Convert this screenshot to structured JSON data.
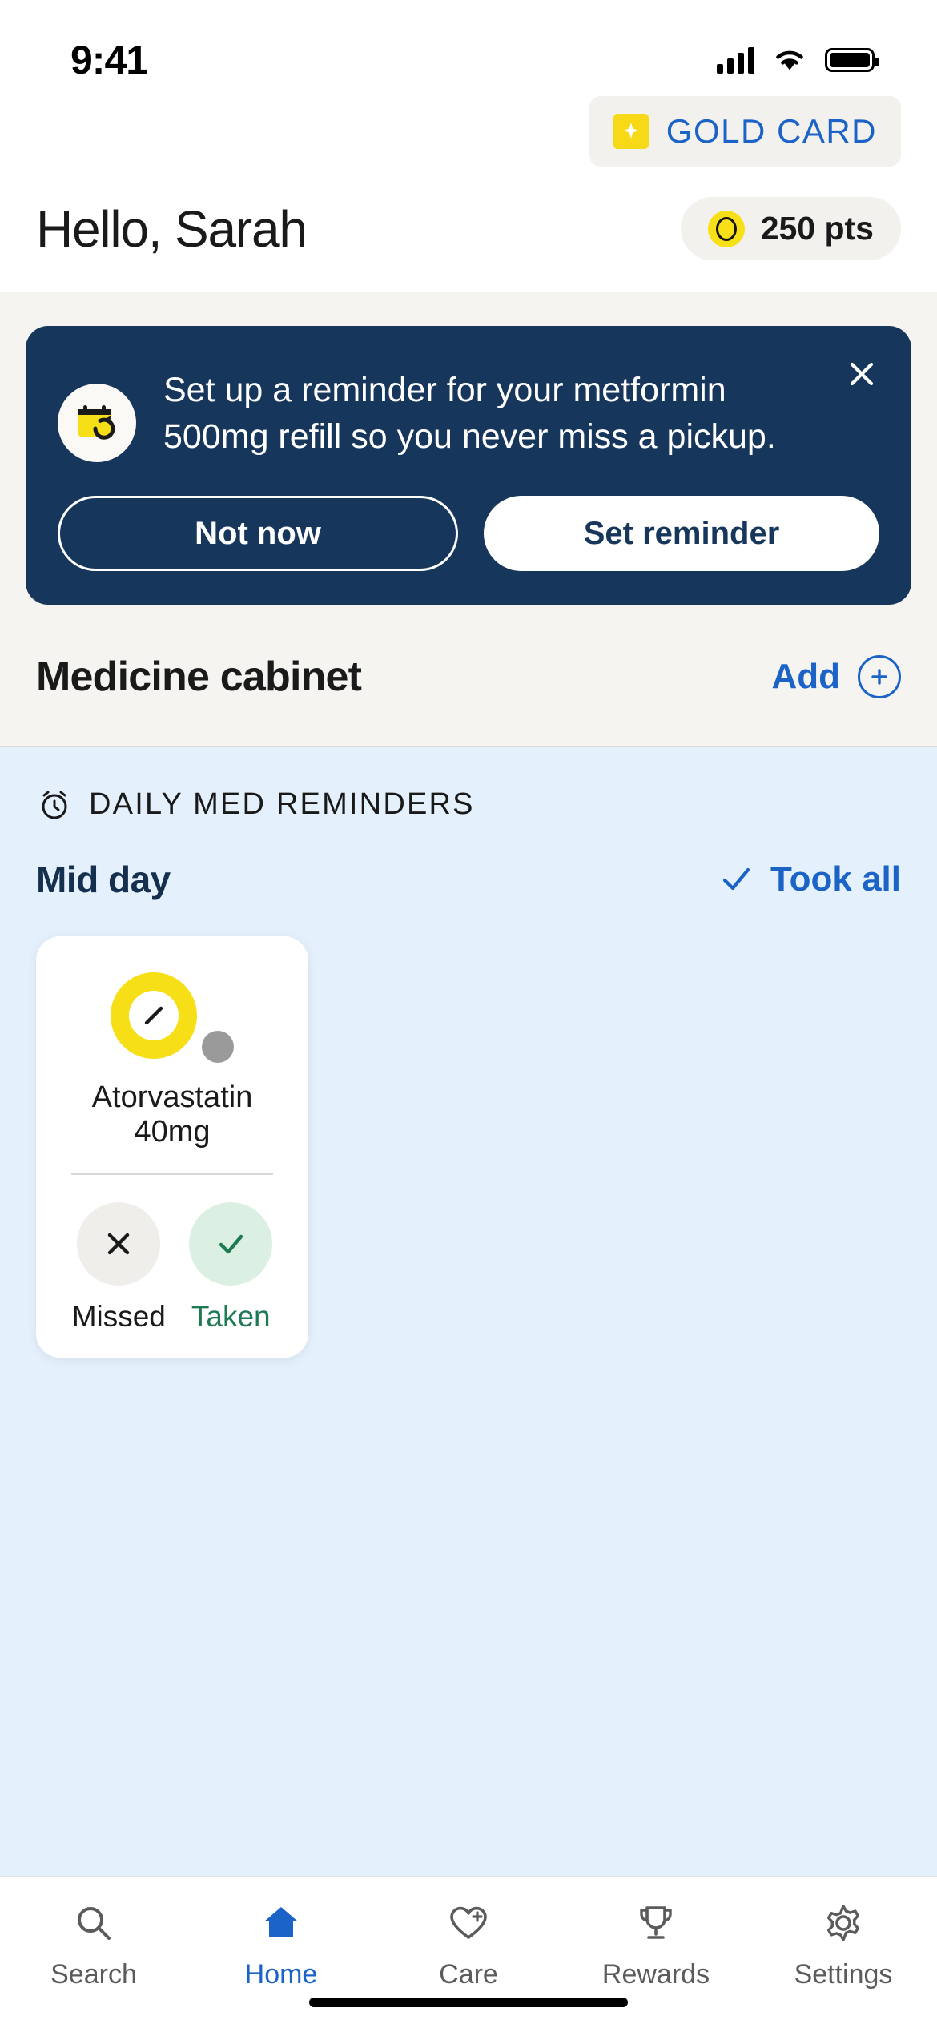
{
  "status_bar": {
    "time": "9:41",
    "cellular_icon": "signal-bars-icon",
    "wifi_icon": "wifi-icon",
    "battery_icon": "battery-icon"
  },
  "header": {
    "gold_card": {
      "label": "GOLD CARD",
      "chip_icon": "sparkle-icon",
      "label_color": "#1C63C8",
      "chip_color": "#F7D917"
    },
    "greeting": "Hello, Sarah",
    "points": {
      "value": "250 pts",
      "coin_icon": "coin-icon",
      "coin_color": "#F7E017"
    }
  },
  "banner": {
    "background_color": "#17365C",
    "icon": "calendar-refill-reminder-icon",
    "message": "Set up a reminder for your metformin 500mg refill so you never miss a pickup.",
    "close_icon": "close-icon",
    "secondary_button": "Not now",
    "primary_button": "Set reminder"
  },
  "medicine_cabinet": {
    "title": "Medicine cabinet",
    "add_label": "Add",
    "add_icon": "plus-circle-icon",
    "accent_color": "#1C63C8"
  },
  "reminders": {
    "section_icon": "alarm-clock-icon",
    "section_label": "DAILY MED REMINDERS",
    "background_color": "#E4F0FB",
    "time_of_day": "Mid day",
    "took_all_label": "Took all",
    "took_all_icon": "check-icon",
    "cards": [
      {
        "pill_icon": "pill-tablet-icon",
        "pill_color": "#F7DF17",
        "status_dot": "status-dot-grey",
        "status_dot_color": "#9A9A9A",
        "name": "Atorvastatin 40mg",
        "actions": [
          {
            "icon": "x-icon",
            "label": "Missed",
            "color": "#1A1A1A",
            "circle_color": "#EFEEEB"
          },
          {
            "icon": "check-icon",
            "label": "Taken",
            "color": "#1E7A52",
            "circle_color": "#DCEFE3"
          }
        ]
      }
    ]
  },
  "tabbar": {
    "active_color": "#1C63C8",
    "inactive_color": "#5B5B5B",
    "items": [
      {
        "label": "Search",
        "icon": "search-icon",
        "active": false
      },
      {
        "label": "Home",
        "icon": "home-icon",
        "active": true
      },
      {
        "label": "Care",
        "icon": "heart-plus-icon",
        "active": false
      },
      {
        "label": "Rewards",
        "icon": "trophy-icon",
        "active": false
      },
      {
        "label": "Settings",
        "icon": "gear-icon",
        "active": false
      }
    ]
  }
}
